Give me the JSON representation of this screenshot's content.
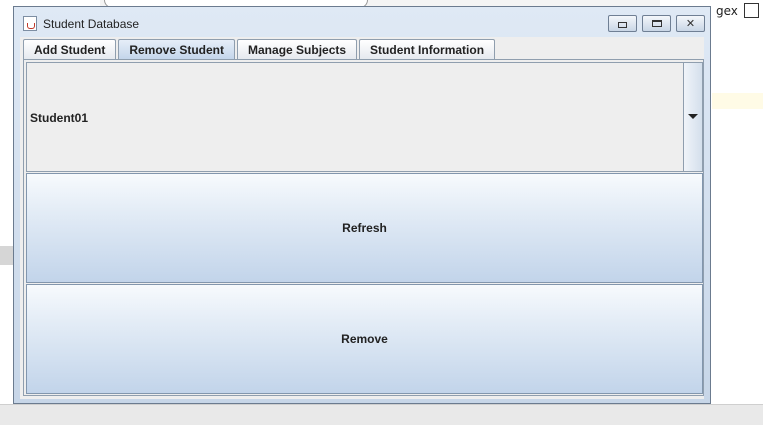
{
  "background": {
    "regex_label": "gex"
  },
  "window": {
    "title": "Student Database",
    "controls": {
      "minimize": "minimize",
      "maximize": "maximize",
      "close": "close"
    },
    "tabs": [
      {
        "label": "Add Student",
        "selected": false
      },
      {
        "label": "Remove Student",
        "selected": true
      },
      {
        "label": "Manage Subjects",
        "selected": false
      },
      {
        "label": "Student Information",
        "selected": false
      }
    ],
    "panel": {
      "student_select": {
        "value": "Student01"
      },
      "refresh_label": "Refresh",
      "remove_label": "Remove"
    }
  },
  "colors": {
    "window_frame": "#c7d6e8",
    "button_top": "#f7fafd",
    "button_bottom": "#c2d4ea",
    "panel_bg": "#eeeeee"
  }
}
